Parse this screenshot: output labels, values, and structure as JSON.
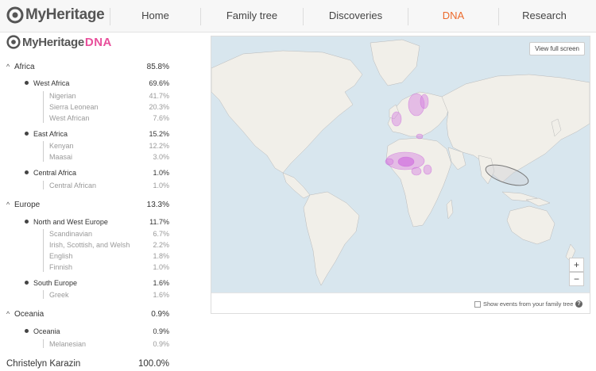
{
  "brand": {
    "name": "MyHeritage",
    "dna_suffix": "DNA",
    "accent": "#ec6a2c",
    "dna_color": "#e84f9b"
  },
  "nav": {
    "items": [
      {
        "label": "Home"
      },
      {
        "label": "Family tree"
      },
      {
        "label": "Discoveries"
      },
      {
        "label": "DNA",
        "active": true
      },
      {
        "label": "Research"
      }
    ]
  },
  "ethnicity": {
    "regions": [
      {
        "name": "Africa",
        "percent": "85.8%",
        "groups": [
          {
            "name": "West Africa",
            "percent": "69.6%",
            "items": [
              {
                "name": "Nigerian",
                "percent": "41.7%"
              },
              {
                "name": "Sierra Leonean",
                "percent": "20.3%"
              },
              {
                "name": "West African",
                "percent": "7.6%"
              }
            ]
          },
          {
            "name": "East Africa",
            "percent": "15.2%",
            "items": [
              {
                "name": "Kenyan",
                "percent": "12.2%"
              },
              {
                "name": "Maasai",
                "percent": "3.0%"
              }
            ]
          },
          {
            "name": "Central Africa",
            "percent": "1.0%",
            "items": [
              {
                "name": "Central African",
                "percent": "1.0%"
              }
            ]
          }
        ]
      },
      {
        "name": "Europe",
        "percent": "13.3%",
        "groups": [
          {
            "name": "North and West Europe",
            "percent": "11.7%",
            "items": [
              {
                "name": "Scandinavian",
                "percent": "6.7%"
              },
              {
                "name": "Irish, Scottish, and Welsh",
                "percent": "2.2%"
              },
              {
                "name": "English",
                "percent": "1.8%"
              },
              {
                "name": "Finnish",
                "percent": "1.0%"
              }
            ]
          },
          {
            "name": "South Europe",
            "percent": "1.6%",
            "items": [
              {
                "name": "Greek",
                "percent": "1.6%"
              }
            ]
          }
        ]
      },
      {
        "name": "Oceania",
        "percent": "0.9%",
        "groups": [
          {
            "name": "Oceania",
            "percent": "0.9%",
            "items": [
              {
                "name": "Melanesian",
                "percent": "0.9%"
              }
            ]
          }
        ]
      }
    ],
    "total": {
      "name": "Christelyn Karazin",
      "percent": "100.0%"
    }
  },
  "map": {
    "full_screen_label": "View full screen",
    "zoom_in": "+",
    "zoom_out": "−",
    "show_events_label": "Show events from your family tree",
    "help_icon": "?",
    "ocean_color": "#d8e6ee",
    "land_color": "#f1efe9",
    "highlight_color": "#d57fe0"
  }
}
